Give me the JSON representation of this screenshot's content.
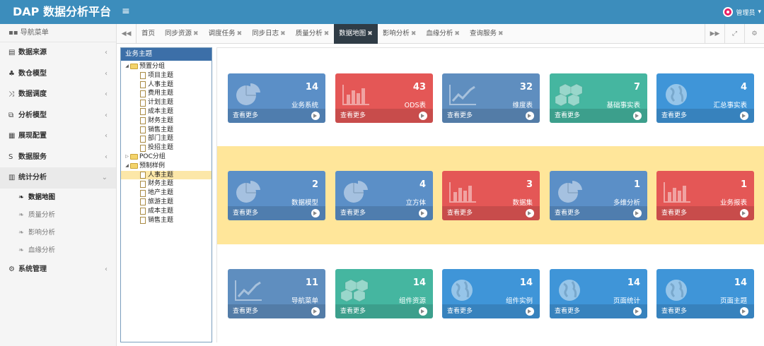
{
  "app": {
    "title": "DAP 数据分析平台",
    "menu_toggle": "≡",
    "user": "管理员"
  },
  "sidebar": {
    "header": "导航菜单",
    "items": [
      {
        "icon": "▤",
        "label": "数据来源",
        "caret": "‹"
      },
      {
        "icon": "♣",
        "label": "数仓模型",
        "caret": "‹"
      },
      {
        "icon": "⤨",
        "label": "数据调度",
        "caret": "‹"
      },
      {
        "icon": "⧉",
        "label": "分析模型",
        "caret": "‹"
      },
      {
        "icon": "▦",
        "label": "展现配置",
        "caret": "‹"
      },
      {
        "icon": "S",
        "label": "数据服务",
        "caret": "‹"
      },
      {
        "icon": "▥",
        "label": "统计分析",
        "caret": "⌄"
      }
    ],
    "subitems": [
      "数据地图",
      "质量分析",
      "影响分析",
      "血缘分析"
    ],
    "last": {
      "icon": "⚙",
      "label": "系统管理",
      "caret": "‹"
    }
  },
  "tabs": {
    "left_nav": "◀◀",
    "items": [
      "首页",
      "同步资源",
      "调度任务",
      "同步日志",
      "质量分析",
      "数据地图",
      "影响分析",
      "血缘分析",
      "查询服务"
    ],
    "close": "✖",
    "right": [
      "▶▶",
      "⤢",
      "⚙"
    ]
  },
  "tree": {
    "title": "业务主题",
    "groups": [
      {
        "name": "预置分组",
        "arrow": "◢",
        "children": [
          "项目主题",
          "人事主题",
          "费用主题",
          "计划主题",
          "成本主题",
          "财务主题",
          "销售主题",
          "部门主题",
          "投招主题"
        ]
      },
      {
        "name": "POC分组",
        "arrow": "▷",
        "children": []
      },
      {
        "name": "预制样例",
        "arrow": "◢",
        "children": [
          "人事主题",
          "财务主题",
          "地产主题",
          "旅游主题",
          "成本主题",
          "销售主题"
        ]
      }
    ]
  },
  "cards": {
    "more_label": "查看更多",
    "rows": [
      [
        {
          "count": "14",
          "label": "业务系统",
          "icon": "pie",
          "color": "#5b8fc7"
        },
        {
          "count": "43",
          "label": "ODS表",
          "icon": "bar",
          "color": "#e45756"
        },
        {
          "count": "32",
          "label": "维度表",
          "icon": "line",
          "color": "#5f8ebf"
        },
        {
          "count": "7",
          "label": "基础事实表",
          "icon": "cubes",
          "color": "#45b6a0"
        },
        {
          "count": "4",
          "label": "汇总事实表",
          "icon": "globe",
          "color": "#3f95d8"
        }
      ],
      [
        {
          "count": "2",
          "label": "数据模型",
          "icon": "pie",
          "color": "#5b8fc7"
        },
        {
          "count": "4",
          "label": "立方体",
          "icon": "pie",
          "color": "#5b8fc7"
        },
        {
          "count": "3",
          "label": "数据集",
          "icon": "bar",
          "color": "#e45756"
        },
        {
          "count": "1",
          "label": "多维分析",
          "icon": "pie",
          "color": "#5b8fc7"
        },
        {
          "count": "1",
          "label": "业务报表",
          "icon": "bar",
          "color": "#e45756"
        }
      ],
      [
        {
          "count": "11",
          "label": "导航菜单",
          "icon": "line",
          "color": "#5f8ebf"
        },
        {
          "count": "14",
          "label": "组件资源",
          "icon": "cubes",
          "color": "#45b6a0"
        },
        {
          "count": "14",
          "label": "组件实例",
          "icon": "globe",
          "color": "#3f95d8"
        },
        {
          "count": "14",
          "label": "页面统计",
          "icon": "globe",
          "color": "#3f95d8"
        },
        {
          "count": "14",
          "label": "页面主题",
          "icon": "globe",
          "color": "#3f95d8"
        }
      ]
    ]
  }
}
